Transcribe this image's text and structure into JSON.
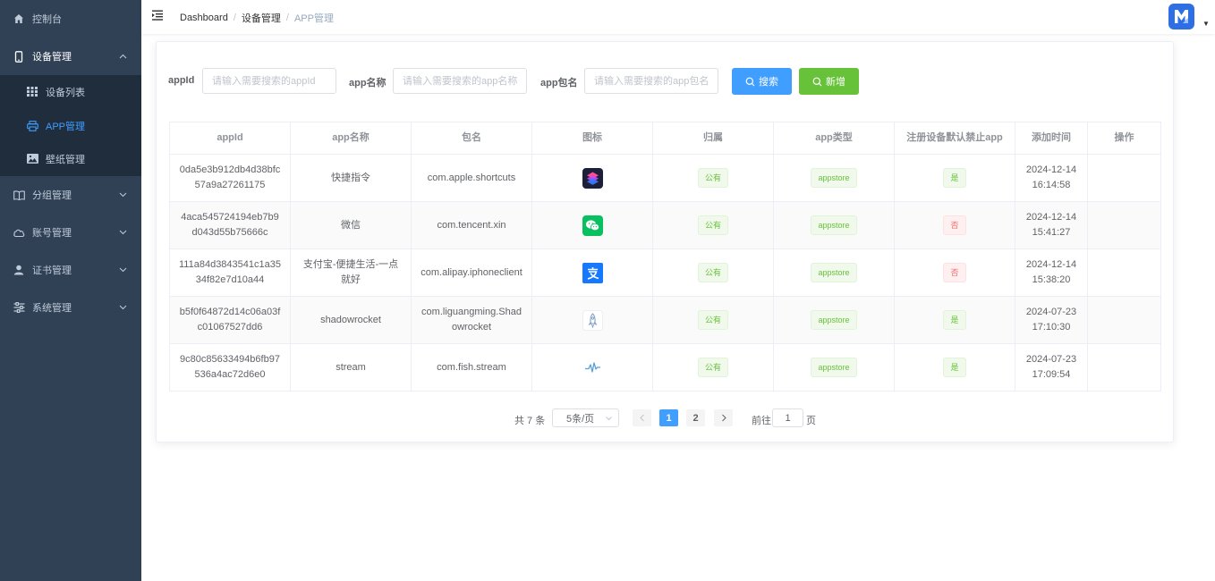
{
  "sidebar": {
    "items": [
      {
        "label": "控制台",
        "icon": "home-icon"
      },
      {
        "label": "设备管理",
        "icon": "phone-icon"
      },
      {
        "label": "分组管理",
        "icon": "book-icon"
      },
      {
        "label": "账号管理",
        "icon": "cloud-icon"
      },
      {
        "label": "证书管理",
        "icon": "user-icon"
      },
      {
        "label": "系统管理",
        "icon": "sliders-icon"
      }
    ],
    "sub_items": [
      {
        "label": "设备列表",
        "icon": "grid-icon"
      },
      {
        "label": "APP管理",
        "icon": "printer-icon"
      },
      {
        "label": "壁纸管理",
        "icon": "picture-icon"
      }
    ],
    "colors": {
      "bg": "#304156",
      "submenu_bg": "#1f2d3d",
      "active": "#409eff",
      "text": "#bfcbd9"
    }
  },
  "header": {
    "breadcrumb": [
      "Dashboard",
      "设备管理",
      "APP管理"
    ],
    "separator": "/",
    "avatar_text": "M"
  },
  "search": {
    "appid_label": "appId",
    "appid_placeholder": "请输入需要搜索的appId",
    "name_label": "app名称",
    "name_placeholder": "请输入需要搜索的app名称",
    "package_label": "app包名",
    "package_placeholder": "请输入需要搜索的app包名",
    "search_button": "搜索",
    "add_button": "新增"
  },
  "table": {
    "headers": [
      "appId",
      "app名称",
      "包名",
      "图标",
      "归属",
      "app类型",
      "注册设备默认禁止app",
      "添加时间",
      "操作"
    ],
    "rows": [
      {
        "appid": "0da5e3b912db4d38bfc57a9a27261175",
        "name": "快捷指令",
        "package": "com.apple.shortcuts",
        "icon": "shortcuts-icon",
        "owner": "公有",
        "type": "appstore",
        "forbid": "是",
        "time": "2024-12-14 16:14:58"
      },
      {
        "appid": "4aca545724194eb7b9d043d55b75666c",
        "name": "微信",
        "package": "com.tencent.xin",
        "icon": "wechat-icon",
        "owner": "公有",
        "type": "appstore",
        "forbid": "否",
        "time": "2024-12-14 15:41:27"
      },
      {
        "appid": "111a84d3843541c1a3534f82e7d10a44",
        "name": "支付宝-便捷生活-一点就好",
        "package": "com.alipay.iphoneclient",
        "icon": "alipay-icon",
        "owner": "公有",
        "type": "appstore",
        "forbid": "否",
        "time": "2024-12-14 15:38:20"
      },
      {
        "appid": "b5f0f64872d14c06a03fc01067527dd6",
        "name": "shadowrocket",
        "package": "com.liguangming.Shadowrocket",
        "icon": "shadowrocket-icon",
        "owner": "公有",
        "type": "appstore",
        "forbid": "是",
        "time": "2024-07-23 17:10:30"
      },
      {
        "appid": "9c80c85633494b6fb97536a4ac72d6e0",
        "name": "stream",
        "package": "com.fish.stream",
        "icon": "stream-icon",
        "owner": "公有",
        "type": "appstore",
        "forbid": "是",
        "time": "2024-07-23 17:09:54"
      }
    ]
  },
  "pagination": {
    "total_text": "共 7 条",
    "page_size": "5条/页",
    "pages": [
      "1",
      "2"
    ],
    "current_page": 1,
    "goto_label": "前往",
    "goto_value": "1",
    "page_suffix": "页"
  },
  "colors": {
    "primary": "#409eff",
    "success": "#67c23a",
    "danger": "#f56c6c"
  }
}
